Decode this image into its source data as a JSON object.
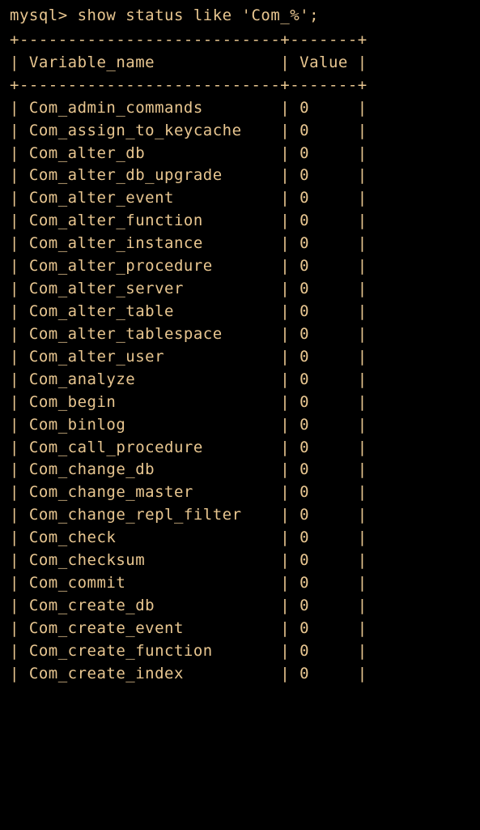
{
  "prompt": "mysql> ",
  "command": "show status like 'Com_%';",
  "border_top": "+---------------------------+-------+",
  "header_line": "| Variable_name             | Value |",
  "border_mid": "+---------------------------+-------+",
  "col1_width": 27,
  "col2_width": 7,
  "rows": [
    {
      "name": "Com_admin_commands",
      "value": "0"
    },
    {
      "name": "Com_assign_to_keycache",
      "value": "0"
    },
    {
      "name": "Com_alter_db",
      "value": "0"
    },
    {
      "name": "Com_alter_db_upgrade",
      "value": "0"
    },
    {
      "name": "Com_alter_event",
      "value": "0"
    },
    {
      "name": "Com_alter_function",
      "value": "0"
    },
    {
      "name": "Com_alter_instance",
      "value": "0"
    },
    {
      "name": "Com_alter_procedure",
      "value": "0"
    },
    {
      "name": "Com_alter_server",
      "value": "0"
    },
    {
      "name": "Com_alter_table",
      "value": "0"
    },
    {
      "name": "Com_alter_tablespace",
      "value": "0"
    },
    {
      "name": "Com_alter_user",
      "value": "0"
    },
    {
      "name": "Com_analyze",
      "value": "0"
    },
    {
      "name": "Com_begin",
      "value": "0"
    },
    {
      "name": "Com_binlog",
      "value": "0"
    },
    {
      "name": "Com_call_procedure",
      "value": "0"
    },
    {
      "name": "Com_change_db",
      "value": "0"
    },
    {
      "name": "Com_change_master",
      "value": "0"
    },
    {
      "name": "Com_change_repl_filter",
      "value": "0"
    },
    {
      "name": "Com_check",
      "value": "0"
    },
    {
      "name": "Com_checksum",
      "value": "0"
    },
    {
      "name": "Com_commit",
      "value": "0"
    },
    {
      "name": "Com_create_db",
      "value": "0"
    },
    {
      "name": "Com_create_event",
      "value": "0"
    },
    {
      "name": "Com_create_function",
      "value": "0"
    },
    {
      "name": "Com_create_index",
      "value": "0"
    }
  ]
}
